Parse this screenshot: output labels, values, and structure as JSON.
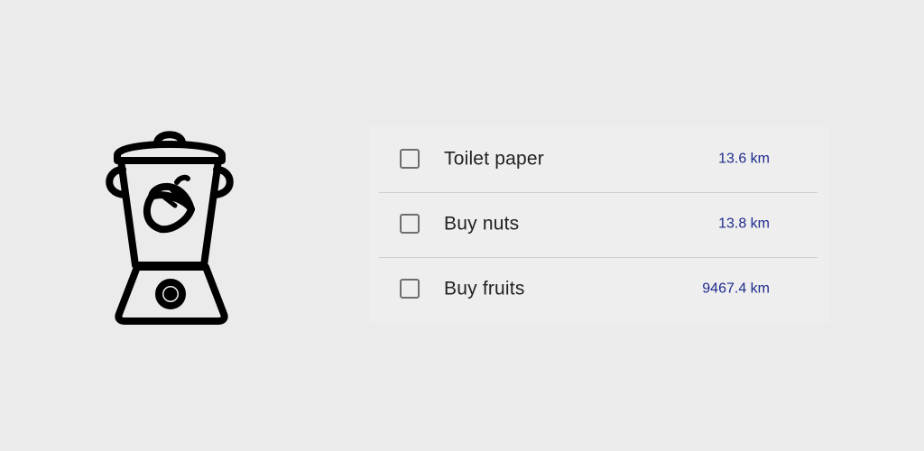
{
  "logo": {
    "icon": "blender-with-acorn-icon"
  },
  "todo": {
    "items": [
      {
        "label": "Toilet paper",
        "distance": "13.6 km",
        "checked": false
      },
      {
        "label": "Buy nuts",
        "distance": "13.8 km",
        "checked": false
      },
      {
        "label": "Buy fruits",
        "distance": "9467.4 km",
        "checked": false
      }
    ]
  },
  "colors": {
    "background": "#ebebeb",
    "card": "#eeeeee",
    "distance_text": "#1e2b8c",
    "label_text": "#222222",
    "checkbox_border": "#6e6e6e",
    "divider": "#cfcfcf"
  }
}
